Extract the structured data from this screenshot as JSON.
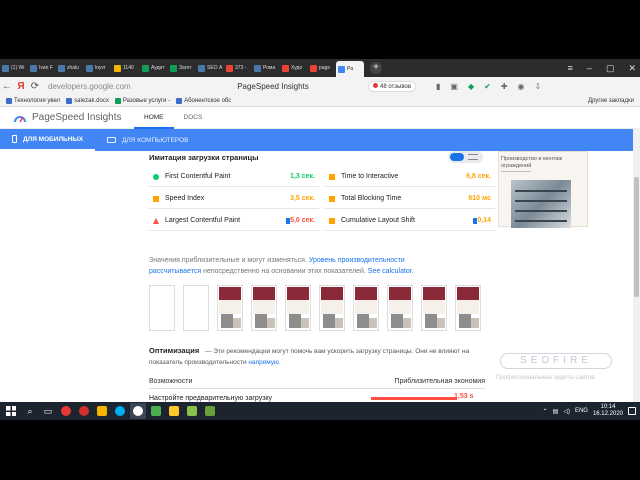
{
  "browser": {
    "tabs": [
      {
        "label": "(1) Wi",
        "color": "#4a76a8"
      },
      {
        "label": "Ivan F",
        "color": "#4a76a8"
      },
      {
        "label": "zhalu",
        "color": "#4a76a8"
      },
      {
        "label": "loyvr",
        "color": "#4a76a8"
      },
      {
        "label": "1140",
        "color": "#f4b400"
      },
      {
        "label": "Аудит",
        "color": "#0f9d58"
      },
      {
        "label": "Загот",
        "color": "#0f9d58"
      },
      {
        "label": "SEO А",
        "color": "#4a76a8"
      },
      {
        "label": "373 -",
        "color": "#ea4335"
      },
      {
        "label": "Рома",
        "color": "#4a76a8"
      },
      {
        "label": "Худо",
        "color": "#ea4335"
      },
      {
        "label": "page",
        "color": "#ea4335"
      },
      {
        "label": "Pa",
        "color": "#4285f4"
      }
    ],
    "url": "developers.google.com",
    "title": "PageSpeed Insights",
    "reviews": "48 отзывов",
    "bookmarks": [
      "Технология увел",
      "salezak.docx",
      "Разовые услуги -",
      "Абонентское обс"
    ],
    "bookmarks_other": "Другие закладки"
  },
  "psi": {
    "title": "PageSpeed Insights",
    "nav": [
      "HOME",
      "DOCS"
    ],
    "device_tabs": [
      "ДЛЯ МОБИЛЬНЫХ",
      "ДЛЯ КОМПЬЮТЕРОВ"
    ],
    "section_title": "Имитация загрузки страницы",
    "metrics": [
      {
        "name": "First Contentful Paint",
        "value": "1,3 сек.",
        "status": "good"
      },
      {
        "name": "Time to Interactive",
        "value": "6,8 сек.",
        "status": "average"
      },
      {
        "name": "Speed Index",
        "value": "3,5 сек.",
        "status": "average"
      },
      {
        "name": "Total Blocking Time",
        "value": "610 мс",
        "status": "average"
      },
      {
        "name": "Largest Contentful Paint",
        "value": "5,0 сек.",
        "status": "poor"
      },
      {
        "name": "Cumulative Layout Shift",
        "value": "0,14",
        "status": "average"
      }
    ],
    "note_prefix": "Значения приблизительные и могут изменяться.",
    "note_link1": "Уровень производительности рассчитывается",
    "note_mid": "непосредственно на основании этих показателей.",
    "note_link2": "See calculator.",
    "opt_title": "Оптимизация",
    "opt_text": "— Эти рекомендации могут помочь вам ускорить загрузку страницы. Они не влияют на показатель производительности",
    "opt_link": "напрямую.",
    "opp_col1": "Возможности",
    "opp_col2": "Приблизительная экономия",
    "opp_first_name": "Настройте предварительную загрузку",
    "opp_first_value": "1,53 s"
  },
  "side_card": {
    "text": "Производство и монтаж ограждений"
  },
  "watermark": {
    "logo": "SEOFIRE",
    "tagline": "Профессиональные аудиты сайтов"
  },
  "taskbar": {
    "lang": "ENG",
    "time": "10:14",
    "date": "16.12.2020"
  },
  "colors": {
    "good": "#0cce6b",
    "average": "#ffa400",
    "poor": "#ff4e42",
    "accent": "#4285f4",
    "link": "#1a73e8"
  }
}
